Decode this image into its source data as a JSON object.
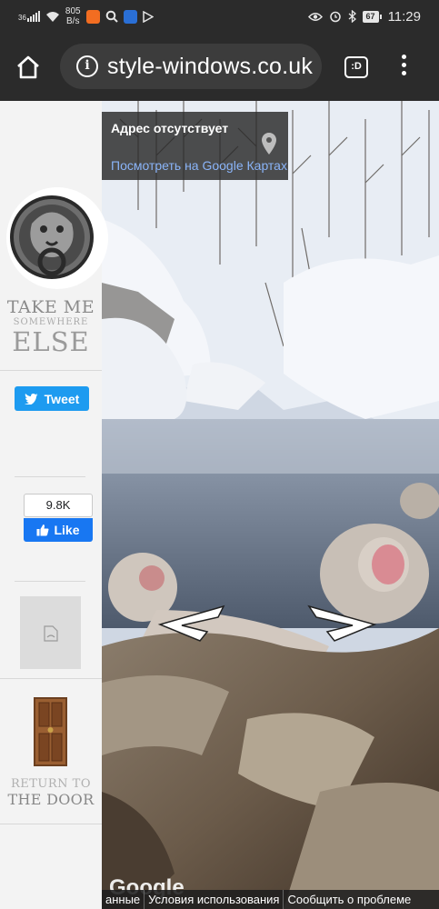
{
  "status_bar": {
    "signal": "36",
    "net_speed_value": "805",
    "net_speed_unit": "B/s",
    "battery": "67",
    "time": "11:29"
  },
  "browser": {
    "url": "style-windows.co.uk",
    "tabs_label": ":D"
  },
  "street_view": {
    "address_title": "Адрес отсутствует",
    "view_link": "Посмотреть на Google Картах",
    "google_logo": "Google",
    "footer_links": [
      "анные",
      "Условия использования",
      "Сообщить о проблеме"
    ]
  },
  "sidebar": {
    "take_me_line1": "TAKE ME",
    "take_me_line2": "SOMEWHERE",
    "take_me_line3": "ELSE",
    "tweet_label": "Tweet",
    "like_count": "9.8K",
    "like_label": "Like",
    "return_line1": "RETURN TO",
    "return_line2": "THE DOOR"
  },
  "colors": {
    "tweet": "#1d9bf0",
    "facebook": "#1877f2",
    "link": "#8ab4f8",
    "toolbar": "#2b2b2b"
  },
  "icons": [
    "home-icon",
    "info-icon",
    "menu-icon",
    "map-pin-icon",
    "twitter-bird-icon",
    "thumbs-up-icon",
    "broken-image-icon",
    "lion-knocker-icon",
    "door-icon",
    "chevron-left-icon",
    "chevron-right-icon"
  ]
}
